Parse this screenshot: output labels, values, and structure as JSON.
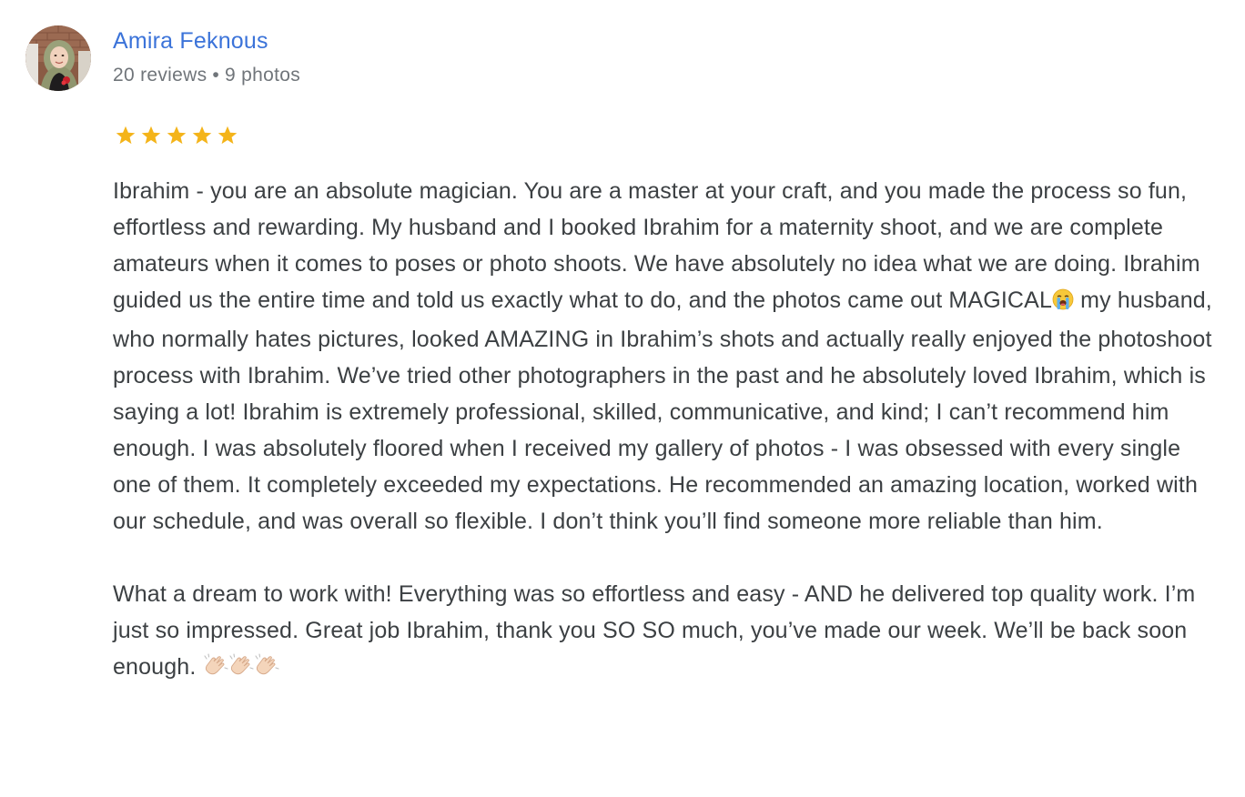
{
  "reviewer": {
    "name": "Amira Feknous",
    "review_count": "20 reviews",
    "separator": "•",
    "photo_count": "9 photos"
  },
  "rating": {
    "stars": 5,
    "max_stars": 5,
    "star_color": "#f4b41a"
  },
  "review": {
    "paragraph_1_before_emoji": "Ibrahim - you are an absolute magician. You are a master at your craft, and you made the process so fun, effortless and rewarding. My husband and I booked Ibrahim for a maternity shoot, and we are complete amateurs when it comes to poses or photo shoots. We have absolutely no idea what we are doing. Ibrahim guided us the entire time and told us exactly what to do, and the photos came out MAGICAL",
    "paragraph_1_emoji": "loudly-crying-face-emoji",
    "paragraph_1_after_emoji": " my husband, who normally hates pictures, looked AMAZING in Ibrahim’s shots and actually really enjoyed the photoshoot process with Ibrahim. We’ve tried other photographers in the past and he absolutely loved Ibrahim, which is saying a lot! Ibrahim is extremely professional, skilled, communicative, and kind; I can’t recommend him enough. I was absolutely floored when I received my gallery of photos - I was obsessed with every single one of them. It completely exceeded my expectations. He recommended an amazing location, worked with our schedule, and was overall so flexible. I don’t think you’ll find someone more reliable than him.",
    "paragraph_2": "What a dream to work with! Everything was so effortless and easy - AND he delivered top quality work. I’m just so impressed. Great job Ibrahim, thank you SO SO much, you’ve made our week. We’ll be back soon enough. ",
    "paragraph_2_emojis": [
      "clapping-hands-emoji",
      "clapping-hands-emoji",
      "clapping-hands-emoji"
    ]
  },
  "colors": {
    "name_link": "#3b73d9",
    "meta_text": "#70757a",
    "body_text": "#3c4043"
  }
}
